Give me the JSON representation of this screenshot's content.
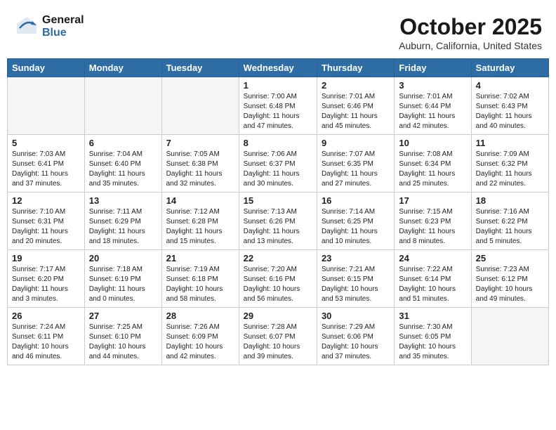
{
  "header": {
    "logo_general": "General",
    "logo_blue": "Blue",
    "month_title": "October 2025",
    "subtitle": "Auburn, California, United States"
  },
  "days_of_week": [
    "Sunday",
    "Monday",
    "Tuesday",
    "Wednesday",
    "Thursday",
    "Friday",
    "Saturday"
  ],
  "weeks": [
    {
      "days": [
        {
          "number": "",
          "empty": true
        },
        {
          "number": "",
          "empty": true
        },
        {
          "number": "",
          "empty": true
        },
        {
          "number": "1",
          "sunrise": "7:00 AM",
          "sunset": "6:48 PM",
          "daylight": "11 hours and 47 minutes."
        },
        {
          "number": "2",
          "sunrise": "7:01 AM",
          "sunset": "6:46 PM",
          "daylight": "11 hours and 45 minutes."
        },
        {
          "number": "3",
          "sunrise": "7:01 AM",
          "sunset": "6:44 PM",
          "daylight": "11 hours and 42 minutes."
        },
        {
          "number": "4",
          "sunrise": "7:02 AM",
          "sunset": "6:43 PM",
          "daylight": "11 hours and 40 minutes."
        }
      ]
    },
    {
      "days": [
        {
          "number": "5",
          "sunrise": "7:03 AM",
          "sunset": "6:41 PM",
          "daylight": "11 hours and 37 minutes."
        },
        {
          "number": "6",
          "sunrise": "7:04 AM",
          "sunset": "6:40 PM",
          "daylight": "11 hours and 35 minutes."
        },
        {
          "number": "7",
          "sunrise": "7:05 AM",
          "sunset": "6:38 PM",
          "daylight": "11 hours and 32 minutes."
        },
        {
          "number": "8",
          "sunrise": "7:06 AM",
          "sunset": "6:37 PM",
          "daylight": "11 hours and 30 minutes."
        },
        {
          "number": "9",
          "sunrise": "7:07 AM",
          "sunset": "6:35 PM",
          "daylight": "11 hours and 27 minutes."
        },
        {
          "number": "10",
          "sunrise": "7:08 AM",
          "sunset": "6:34 PM",
          "daylight": "11 hours and 25 minutes."
        },
        {
          "number": "11",
          "sunrise": "7:09 AM",
          "sunset": "6:32 PM",
          "daylight": "11 hours and 22 minutes."
        }
      ]
    },
    {
      "days": [
        {
          "number": "12",
          "sunrise": "7:10 AM",
          "sunset": "6:31 PM",
          "daylight": "11 hours and 20 minutes."
        },
        {
          "number": "13",
          "sunrise": "7:11 AM",
          "sunset": "6:29 PM",
          "daylight": "11 hours and 18 minutes."
        },
        {
          "number": "14",
          "sunrise": "7:12 AM",
          "sunset": "6:28 PM",
          "daylight": "11 hours and 15 minutes."
        },
        {
          "number": "15",
          "sunrise": "7:13 AM",
          "sunset": "6:26 PM",
          "daylight": "11 hours and 13 minutes."
        },
        {
          "number": "16",
          "sunrise": "7:14 AM",
          "sunset": "6:25 PM",
          "daylight": "11 hours and 10 minutes."
        },
        {
          "number": "17",
          "sunrise": "7:15 AM",
          "sunset": "6:23 PM",
          "daylight": "11 hours and 8 minutes."
        },
        {
          "number": "18",
          "sunrise": "7:16 AM",
          "sunset": "6:22 PM",
          "daylight": "11 hours and 5 minutes."
        }
      ]
    },
    {
      "days": [
        {
          "number": "19",
          "sunrise": "7:17 AM",
          "sunset": "6:20 PM",
          "daylight": "11 hours and 3 minutes."
        },
        {
          "number": "20",
          "sunrise": "7:18 AM",
          "sunset": "6:19 PM",
          "daylight": "11 hours and 0 minutes."
        },
        {
          "number": "21",
          "sunrise": "7:19 AM",
          "sunset": "6:18 PM",
          "daylight": "10 hours and 58 minutes."
        },
        {
          "number": "22",
          "sunrise": "7:20 AM",
          "sunset": "6:16 PM",
          "daylight": "10 hours and 56 minutes."
        },
        {
          "number": "23",
          "sunrise": "7:21 AM",
          "sunset": "6:15 PM",
          "daylight": "10 hours and 53 minutes."
        },
        {
          "number": "24",
          "sunrise": "7:22 AM",
          "sunset": "6:14 PM",
          "daylight": "10 hours and 51 minutes."
        },
        {
          "number": "25",
          "sunrise": "7:23 AM",
          "sunset": "6:12 PM",
          "daylight": "10 hours and 49 minutes."
        }
      ]
    },
    {
      "days": [
        {
          "number": "26",
          "sunrise": "7:24 AM",
          "sunset": "6:11 PM",
          "daylight": "10 hours and 46 minutes."
        },
        {
          "number": "27",
          "sunrise": "7:25 AM",
          "sunset": "6:10 PM",
          "daylight": "10 hours and 44 minutes."
        },
        {
          "number": "28",
          "sunrise": "7:26 AM",
          "sunset": "6:09 PM",
          "daylight": "10 hours and 42 minutes."
        },
        {
          "number": "29",
          "sunrise": "7:28 AM",
          "sunset": "6:07 PM",
          "daylight": "10 hours and 39 minutes."
        },
        {
          "number": "30",
          "sunrise": "7:29 AM",
          "sunset": "6:06 PM",
          "daylight": "10 hours and 37 minutes."
        },
        {
          "number": "31",
          "sunrise": "7:30 AM",
          "sunset": "6:05 PM",
          "daylight": "10 hours and 35 minutes."
        },
        {
          "number": "",
          "empty": true
        }
      ]
    }
  ]
}
